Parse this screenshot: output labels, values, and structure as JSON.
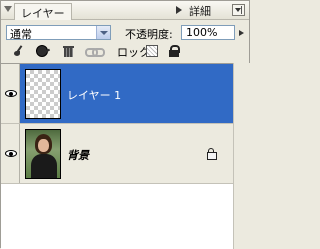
{
  "panel": {
    "tab_label": "レイヤー",
    "details_label": "詳細"
  },
  "controls": {
    "blend_mode": "通常",
    "opacity_label": "不透明度:",
    "opacity_value": "100%",
    "lock_label": "ロック:"
  },
  "layers": [
    {
      "name": "レイヤー 1",
      "visible": true,
      "selected": true,
      "locked": false,
      "thumbnail": "transparent-checker"
    },
    {
      "name": "背景",
      "visible": true,
      "selected": false,
      "locked": true,
      "thumbnail": "photo-woman"
    }
  ],
  "colors": {
    "selection": "#316ac5",
    "panel_bg": "#eceadf"
  }
}
